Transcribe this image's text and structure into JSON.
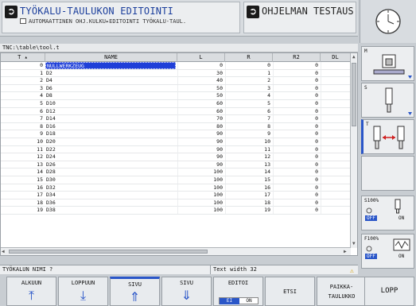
{
  "header": {
    "title": "TYÖKALU-TAULUKON EDITOINTI",
    "subtitle_prefix": "AUTOMAATTINEN OHJ.KULKU",
    "subtitle_suffix": "EDITOINTI TYÖKALU-TAUL.",
    "test_title": "OHJELMAN TESTAUS"
  },
  "path": "TNC:\\table\\tool.t",
  "table": {
    "columns": [
      "T",
      "NAME",
      "L",
      "R",
      "R2",
      "DL"
    ],
    "rows": [
      {
        "t": "0",
        "name": "NULLWERKZEUG",
        "l": "0",
        "r": "0",
        "r2": "0"
      },
      {
        "t": "1",
        "name": "D2",
        "l": "30",
        "r": "1",
        "r2": "0"
      },
      {
        "t": "2",
        "name": "D4",
        "l": "40",
        "r": "2",
        "r2": "0"
      },
      {
        "t": "3",
        "name": "D6",
        "l": "50",
        "r": "3",
        "r2": "0"
      },
      {
        "t": "4",
        "name": "D8",
        "l": "50",
        "r": "4",
        "r2": "0"
      },
      {
        "t": "5",
        "name": "D10",
        "l": "60",
        "r": "5",
        "r2": "0"
      },
      {
        "t": "6",
        "name": "D12",
        "l": "60",
        "r": "6",
        "r2": "0"
      },
      {
        "t": "7",
        "name": "D14",
        "l": "70",
        "r": "7",
        "r2": "0"
      },
      {
        "t": "8",
        "name": "D16",
        "l": "80",
        "r": "8",
        "r2": "0"
      },
      {
        "t": "9",
        "name": "D18",
        "l": "90",
        "r": "9",
        "r2": "0"
      },
      {
        "t": "10",
        "name": "D20",
        "l": "90",
        "r": "10",
        "r2": "0"
      },
      {
        "t": "11",
        "name": "D22",
        "l": "90",
        "r": "11",
        "r2": "0"
      },
      {
        "t": "12",
        "name": "D24",
        "l": "90",
        "r": "12",
        "r2": "0"
      },
      {
        "t": "13",
        "name": "D26",
        "l": "90",
        "r": "13",
        "r2": "0"
      },
      {
        "t": "14",
        "name": "D28",
        "l": "100",
        "r": "14",
        "r2": "0"
      },
      {
        "t": "15",
        "name": "D30",
        "l": "100",
        "r": "15",
        "r2": "0"
      },
      {
        "t": "16",
        "name": "D32",
        "l": "100",
        "r": "16",
        "r2": "0"
      },
      {
        "t": "17",
        "name": "D34",
        "l": "100",
        "r": "17",
        "r2": "0"
      },
      {
        "t": "18",
        "name": "D36",
        "l": "100",
        "r": "18",
        "r2": "0"
      },
      {
        "t": "19",
        "name": "D38",
        "l": "100",
        "r": "19",
        "r2": "0"
      }
    ]
  },
  "status": {
    "prompt": "TYÖKALUN NIMI ?",
    "info": "Text width 32"
  },
  "side": {
    "m_label": "M",
    "s_label": "S",
    "t_label": "T",
    "s_override": "S100%",
    "f_override": "F100%",
    "off": "OFF",
    "on": "ON"
  },
  "softkeys": {
    "alkuun": "ALKUUN",
    "loppuun": "LOPPUUN",
    "sivu1": "SIVU",
    "sivu2": "SIVU",
    "editoi": "EDITOI",
    "editoi_off": "EI",
    "editoi_on": "ON",
    "etsi": "ETSI",
    "paikka_1": "PAIKKA-",
    "paikka_2": "TAULUKKO",
    "lopp": "LOPP"
  },
  "colors": {
    "accent": "#2a56c8",
    "selection": "#1f3fd8",
    "title": "#1c3f9c"
  }
}
